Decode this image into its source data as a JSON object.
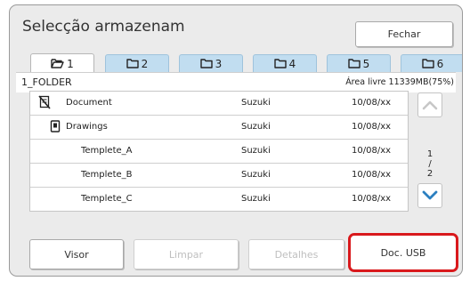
{
  "dialog": {
    "title": "Selecção armazenam",
    "close_label": "Fechar"
  },
  "tabs": [
    {
      "label": "1",
      "active": true,
      "icon": "folder-open-icon"
    },
    {
      "label": "2",
      "active": false,
      "icon": "folder-icon"
    },
    {
      "label": "3",
      "active": false,
      "icon": "folder-icon"
    },
    {
      "label": "4",
      "active": false,
      "icon": "folder-icon"
    },
    {
      "label": "5",
      "active": false,
      "icon": "folder-icon"
    },
    {
      "label": "6",
      "active": false,
      "icon": "folder-icon"
    }
  ],
  "folder": {
    "name": "1_FOLDER",
    "free_space": "Área livre 11339MB(75%)"
  },
  "files": [
    {
      "icon": "crossed-document-icon",
      "name": "Document",
      "owner": "Suzuki",
      "date": "10/08/xx"
    },
    {
      "icon": "lock-icon",
      "name": "Drawings",
      "owner": "Suzuki",
      "date": "10/08/xx"
    },
    {
      "icon": "",
      "name": "Templete_A",
      "owner": "Suzuki",
      "date": "10/08/xx"
    },
    {
      "icon": "",
      "name": "Templete_B",
      "owner": "Suzuki",
      "date": "10/08/xx"
    },
    {
      "icon": "",
      "name": "Templete_C",
      "owner": "Suzuki",
      "date": "10/08/xx"
    }
  ],
  "pager": {
    "current": "1",
    "separator": "/",
    "total": "2"
  },
  "buttons": {
    "visor": "Visor",
    "limpar": "Limpar",
    "detalhes": "Detalhes",
    "doc_usb": "Doc. USB"
  },
  "colors": {
    "tab_inactive": "#c1ddf0",
    "arrow_active": "#2b7fc0",
    "arrow_disabled": "#c7c7c7",
    "highlight": "#d9191c"
  }
}
